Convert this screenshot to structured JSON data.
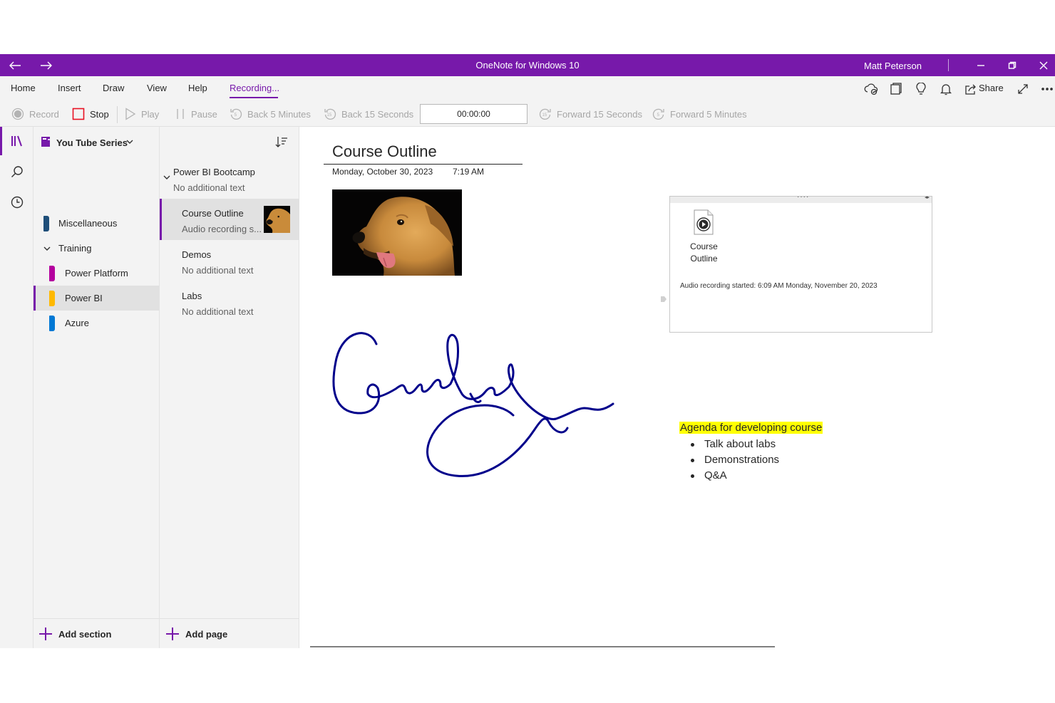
{
  "window": {
    "title": "OneNote for Windows 10",
    "user": "Matt Peterson",
    "accent_color": "#7719aa"
  },
  "ribbon": {
    "tabs": [
      {
        "label": "Home"
      },
      {
        "label": "Insert"
      },
      {
        "label": "Draw"
      },
      {
        "label": "View"
      },
      {
        "label": "Help"
      },
      {
        "label": "Recording..."
      }
    ],
    "share_label": "Share"
  },
  "recording_toolbar": {
    "record": "Record",
    "stop": "Stop",
    "play": "Play",
    "pause": "Pause",
    "back5": "Back 5 Minutes",
    "back15": "Back 15 Seconds",
    "timer": "00:00:00",
    "fwd15": "Forward 15 Seconds",
    "fwd5": "Forward 5 Minutes"
  },
  "notebook": {
    "name": "You Tube Series",
    "sections": [
      {
        "label": "Miscellaneous",
        "color": "#1e4e79"
      },
      {
        "label": "Training"
      },
      {
        "label": "Power Platform",
        "color": "#b4009e"
      },
      {
        "label": "Power BI",
        "color": "#ffb900"
      },
      {
        "label": "Azure",
        "color": "#0078d4"
      }
    ],
    "add_section": "Add section"
  },
  "pages": {
    "items": [
      {
        "title": "Power BI Bootcamp",
        "subtitle": "No additional text"
      },
      {
        "title": "Course Outline",
        "subtitle": "Audio recording s..."
      },
      {
        "title": "Demos",
        "subtitle": "No additional text"
      },
      {
        "title": "Labs",
        "subtitle": "No additional text"
      }
    ],
    "add_page": "Add page"
  },
  "canvas": {
    "title": "Course Outline",
    "date": "Monday, October 30, 2023",
    "time": "7:19 AM",
    "audio_file": {
      "name_line1": "Course",
      "name_line2": "Outline",
      "note": "Audio recording started: 6:09 AM Monday, November 20, 2023"
    },
    "agenda": {
      "title": "Agenda for developing course",
      "items": [
        "Talk about labs",
        "Demonstrations",
        "Q&A"
      ],
      "highlight": "#ffff00"
    },
    "ink_color": "#00008b"
  }
}
